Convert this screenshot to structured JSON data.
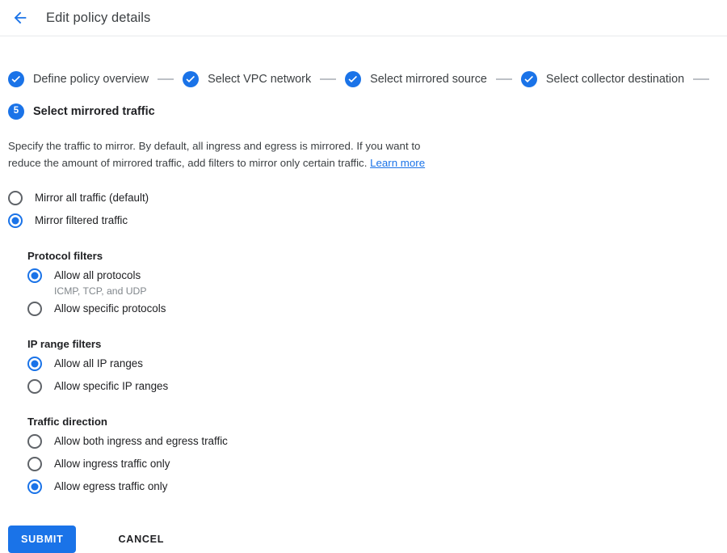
{
  "header": {
    "back_icon": "arrow-left-icon",
    "title": "Edit policy details"
  },
  "colors": {
    "accent": "#1a73e8",
    "text": "#202124",
    "muted": "#80868b",
    "separator": "#bdc1c6"
  },
  "stepper": {
    "steps": [
      {
        "label": "Define policy overview",
        "state": "complete",
        "icon": "check-circle-icon"
      },
      {
        "label": "Select VPC network",
        "state": "complete",
        "icon": "check-circle-icon"
      },
      {
        "label": "Select mirrored source",
        "state": "complete",
        "icon": "check-circle-icon"
      },
      {
        "label": "Select collector destination",
        "state": "complete",
        "icon": "check-circle-icon"
      }
    ],
    "current": {
      "number": "5",
      "label": "Select mirrored traffic"
    }
  },
  "description": {
    "text": "Specify the traffic to mirror. By default, all ingress and egress is mirrored. If you want to reduce the amount of mirrored traffic, add filters to mirror only certain traffic.",
    "link": "Learn more"
  },
  "mirror_mode": {
    "options": [
      {
        "label": "Mirror all traffic (default)",
        "selected": false
      },
      {
        "label": "Mirror filtered traffic",
        "selected": true
      }
    ]
  },
  "protocol_filters": {
    "title": "Protocol filters",
    "options": [
      {
        "label": "Allow all protocols",
        "sub": "ICMP, TCP, and UDP",
        "selected": true
      },
      {
        "label": "Allow specific protocols",
        "sub": "",
        "selected": false
      }
    ]
  },
  "ip_range_filters": {
    "title": "IP range filters",
    "options": [
      {
        "label": "Allow all IP ranges",
        "selected": true
      },
      {
        "label": "Allow specific IP ranges",
        "selected": false
      }
    ]
  },
  "traffic_direction": {
    "title": "Traffic direction",
    "options": [
      {
        "label": "Allow both ingress and egress traffic",
        "selected": false
      },
      {
        "label": "Allow ingress traffic only",
        "selected": false
      },
      {
        "label": "Allow egress traffic only",
        "selected": true
      }
    ]
  },
  "actions": {
    "submit": "SUBMIT",
    "cancel": "CANCEL"
  }
}
